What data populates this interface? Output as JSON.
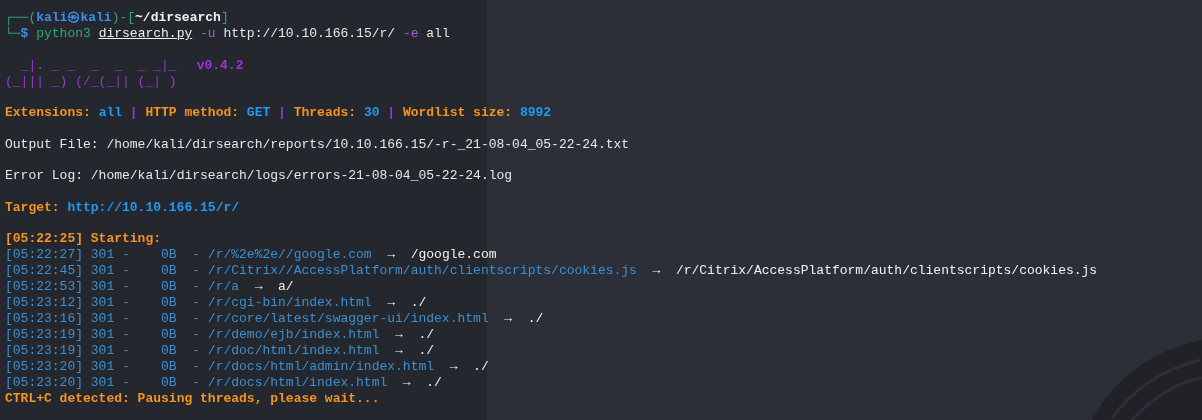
{
  "prompt": {
    "frame_open": "┌──(",
    "user": "kali",
    "at_sign": "㉿",
    "host": "kali",
    "frame_mid": ")-[",
    "path": "~/dirsearch",
    "frame_close": "]",
    "frame_bottom": "└─",
    "sign": "$"
  },
  "command": {
    "program": "python3",
    "script": "dirsearch.py",
    "args": [
      {
        "text": "-u",
        "kind": "flag"
      },
      {
        "text": "http://10.10.166.15/r/",
        "kind": "value"
      },
      {
        "text": "-e",
        "kind": "flag"
      },
      {
        "text": "all",
        "kind": "value"
      }
    ]
  },
  "banner": {
    "art": [
      "  _|. _ _  _  _  _ _|_",
      "(_||| _) (/_(_|| (_| )"
    ],
    "version": "v0.4.2"
  },
  "config": [
    {
      "label": "Extensions:",
      "value": "all",
      "separator": "|"
    },
    {
      "label": "HTTP method:",
      "value": "GET",
      "separator": "|"
    },
    {
      "label": "Threads:",
      "value": "30",
      "separator": "|"
    },
    {
      "label": "Wordlist size:",
      "value": "8992"
    }
  ],
  "output_file": "Output File: /home/kali/dirsearch/reports/10.10.166.15/-r-_21-08-04_05-22-24.txt",
  "error_log": "Error Log: /home/kali/dirsearch/logs/errors-21-08-04_05-22-24.log",
  "target": {
    "label": "Target:",
    "url": "http://10.10.166.15/r/"
  },
  "start": {
    "time": "[05:22:25]",
    "label": "Starting:"
  },
  "results": [
    {
      "line": "[05:22:27] 301 -    0B  - /r/%2e%2e//google.com",
      "arrow": "→",
      "redirect": "/google.com"
    },
    {
      "line": "[05:22:45] 301 -    0B  - /r/Citrix//AccessPlatform/auth/clientscripts/cookies.js",
      "arrow": "→",
      "redirect": "/r/Citrix/AccessPlatform/auth/clientscripts/cookies.js"
    },
    {
      "line": "[05:22:53] 301 -    0B  - /r/a",
      "arrow": "→",
      "redirect": "a/"
    },
    {
      "line": "[05:23:12] 301 -    0B  - /r/cgi-bin/index.html",
      "arrow": "→",
      "redirect": "./"
    },
    {
      "line": "[05:23:16] 301 -    0B  - /r/core/latest/swagger-ui/index.html",
      "arrow": "→",
      "redirect": "./"
    },
    {
      "line": "[05:23:19] 301 -    0B  - /r/demo/ejb/index.html",
      "arrow": "→",
      "redirect": "./"
    },
    {
      "line": "[05:23:19] 301 -    0B  - /r/doc/html/index.html",
      "arrow": "→",
      "redirect": "./"
    },
    {
      "line": "[05:23:20] 301 -    0B  - /r/docs/html/admin/index.html",
      "arrow": "→",
      "redirect": "./"
    },
    {
      "line": "[05:23:20] 301 -    0B  - /r/docs/html/index.html",
      "arrow": "→",
      "redirect": "./"
    }
  ],
  "interrupt": "CTRL+C detected: Pausing threads, please wait..."
}
